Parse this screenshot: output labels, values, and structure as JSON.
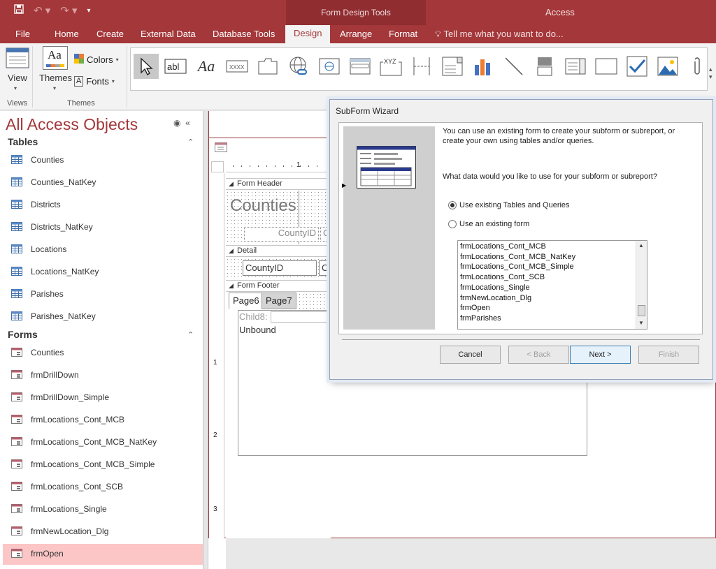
{
  "titlebar": {
    "context_title": "Form Design Tools",
    "app_title": "Access"
  },
  "tabs": [
    "File",
    "Home",
    "Create",
    "External Data",
    "Database Tools",
    "Design",
    "Arrange",
    "Format"
  ],
  "active_tab": "Design",
  "tell_me": "Tell me what you want to do...",
  "ribbon": {
    "view_label": "View",
    "themes_label": "Themes",
    "colors_label": "Colors",
    "fonts_label": "Fonts",
    "group_views": "Views",
    "group_themes": "Themes",
    "xyz_label": "XYZ"
  },
  "nav": {
    "title": "All Access Objects",
    "tables_header": "Tables",
    "forms_header": "Forms",
    "tables": [
      "Counties",
      "Counties_NatKey",
      "Districts",
      "Districts_NatKey",
      "Locations",
      "Locations_NatKey",
      "Parishes",
      "Parishes_NatKey"
    ],
    "forms": [
      "Counties",
      "frmDrillDown",
      "frmDrillDown_Simple",
      "frmLocations_Cont_MCB",
      "frmLocations_Cont_MCB_NatKey",
      "frmLocations_Cont_MCB_Simple",
      "frmLocations_Cont_SCB",
      "frmLocations_Single",
      "frmNewLocation_Dlg",
      "frmOpen"
    ],
    "selected": "frmOpen"
  },
  "designer": {
    "form_header": "Form Header",
    "detail": "Detail",
    "form_footer": "Form Footer",
    "label_title": "Counties",
    "label_countyid": "CountyID",
    "label_co": "Co",
    "textbox_countyid": "CountyID",
    "textbox_co": "Co",
    "page6": "Page6",
    "page7": "Page7",
    "child_label": "Child8:",
    "unbound": "Unbound",
    "ruler_marks": [
      "1",
      "2",
      "3"
    ]
  },
  "dialog": {
    "title": "SubForm Wizard",
    "intro_line1": "You can use an existing form to create your subform or subreport, or",
    "intro_line2": "create your own using tables and/or queries.",
    "question": "What data would you like to use for your subform or subreport?",
    "option_tables": "Use existing Tables and Queries",
    "option_form": "Use an existing form",
    "selected_option": "Use existing Tables and Queries",
    "list_items": [
      "frmLocations_Cont_MCB",
      "frmLocations_Cont_MCB_NatKey",
      "frmLocations_Cont_MCB_Simple",
      "frmLocations_Cont_SCB",
      "frmLocations_Single",
      "frmNewLocation_Dlg",
      "frmOpen",
      "frmParishes"
    ],
    "buttons": {
      "cancel": "Cancel",
      "back": "< Back",
      "next": "Next >",
      "finish": "Finish"
    }
  },
  "colors": {
    "accent": "#a4373a",
    "selected_nav": "#fcc6c6"
  }
}
